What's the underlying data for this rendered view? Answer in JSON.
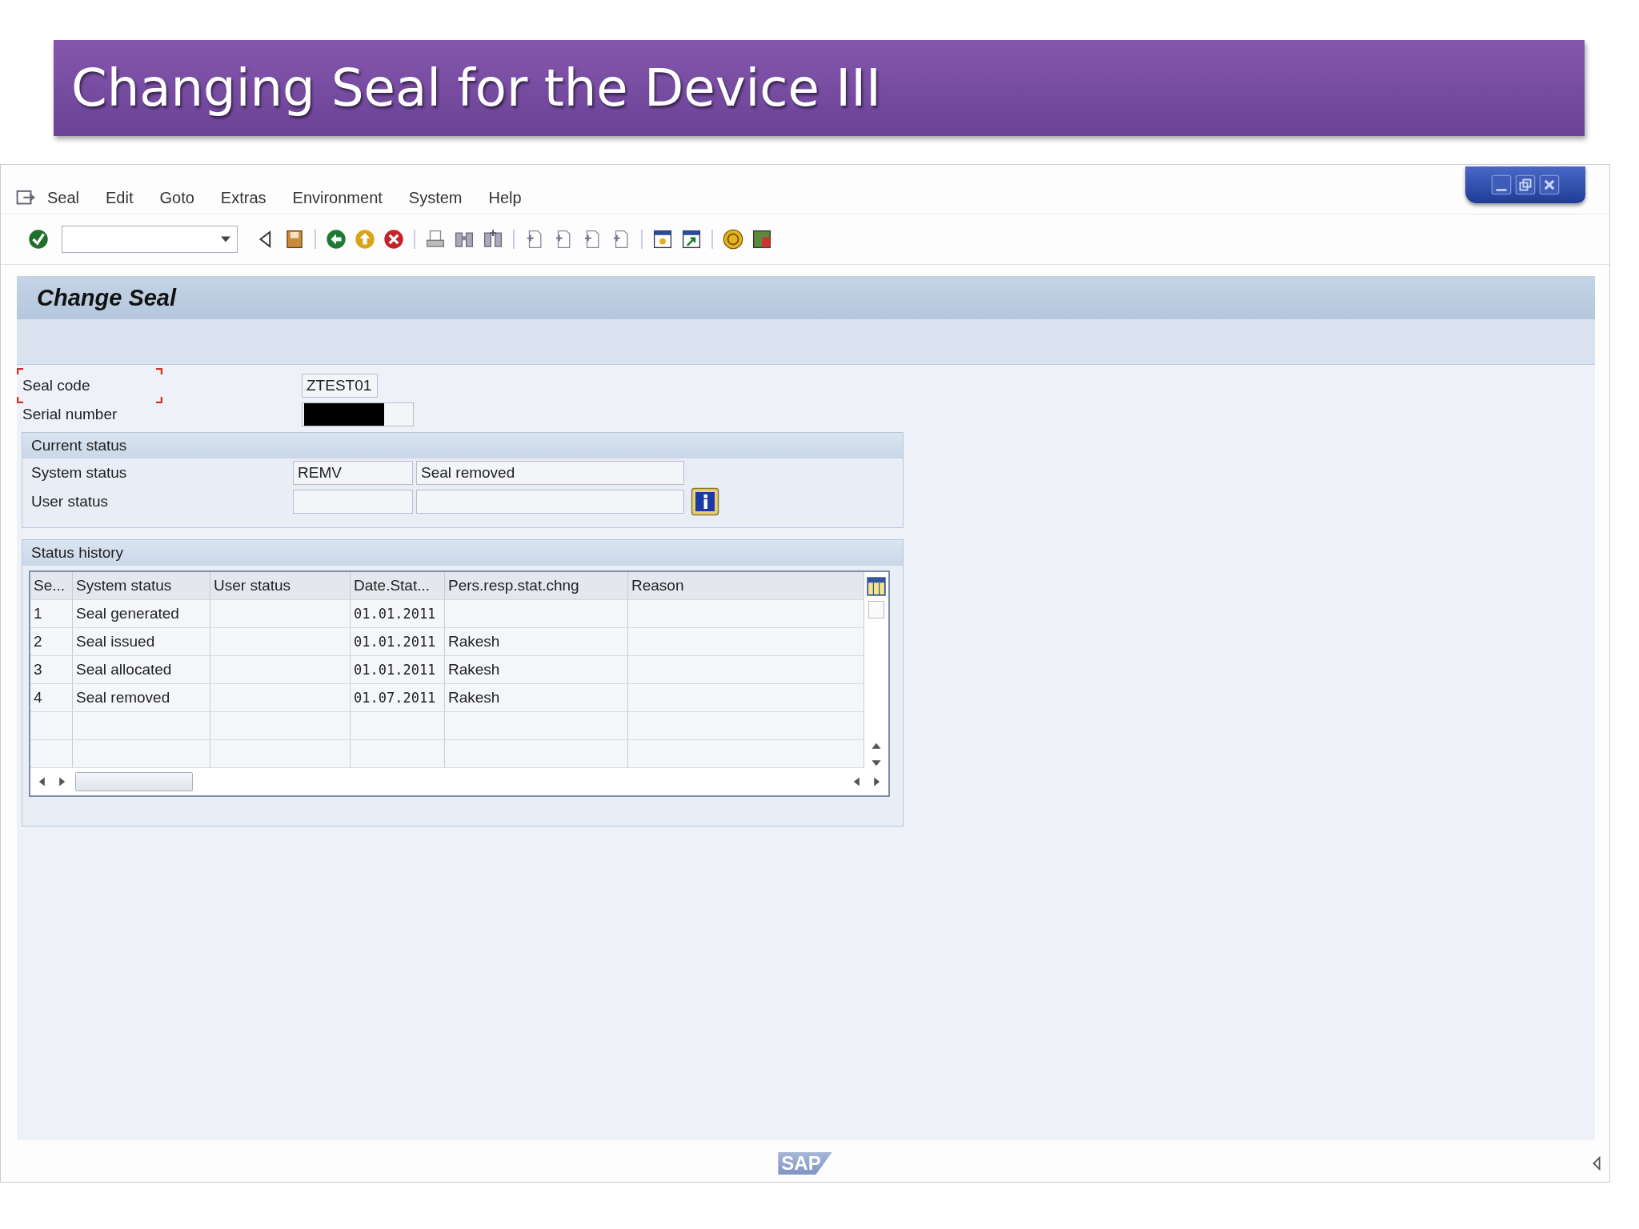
{
  "slide_title": "Changing Seal for the Device III",
  "menu": [
    "Seal",
    "Edit",
    "Goto",
    "Extras",
    "Environment",
    "System",
    "Help"
  ],
  "screen_title": "Change Seal",
  "fields": [
    {
      "label": "Seal code",
      "value": "ZTEST01",
      "focused": true,
      "redacted": false
    },
    {
      "label": "Serial number",
      "focused": false,
      "redacted": true
    }
  ],
  "current_status": {
    "title": "Current status",
    "rows": [
      {
        "label": "System status",
        "code": "REMV",
        "text": "Seal removed"
      },
      {
        "label": "User status"
      }
    ]
  },
  "status_history": {
    "title": "Status history",
    "columns": [
      "Se...",
      "System status",
      "User status",
      "Date.Stat...",
      "Pers.resp.stat.chng",
      "Reason"
    ],
    "select_all": {
      "checked": false
    },
    "rows": [
      [
        "1",
        "Seal generated",
        null,
        "01.01.2011"
      ],
      [
        "2",
        "Seal issued",
        null,
        "01.01.2011",
        "Rakesh"
      ],
      [
        "3",
        "Seal allocated",
        null,
        "01.01.2011",
        "Rakesh"
      ],
      [
        "4",
        "Seal removed",
        null,
        "01.07.2011",
        "Rakesh"
      ]
    ]
  },
  "status_bar": {
    "logo": "SAP"
  }
}
